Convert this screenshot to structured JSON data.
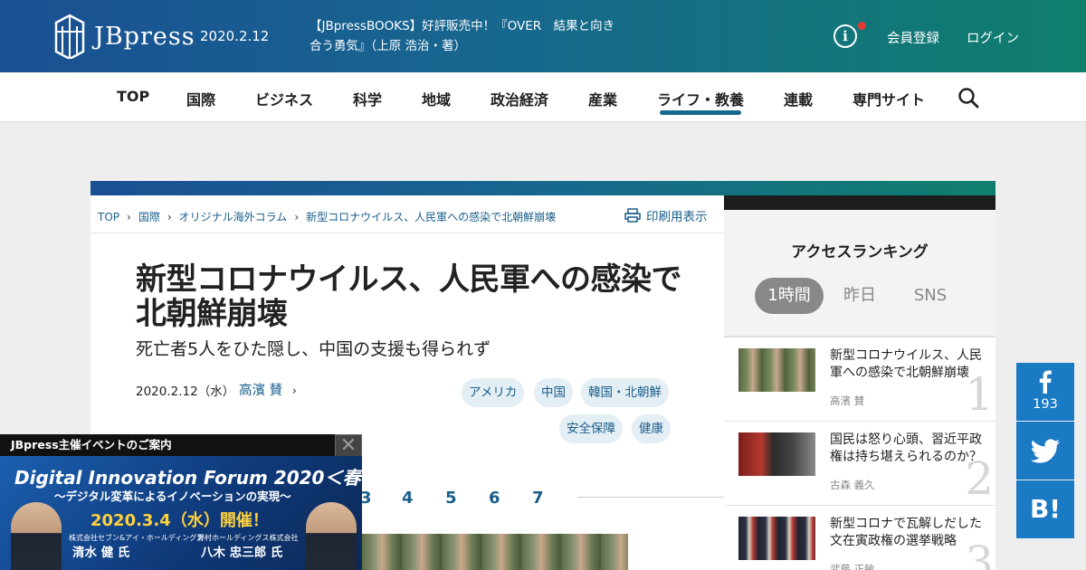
{
  "header": {
    "logo_text": "JBpress",
    "date": "2020.2.12",
    "promo": "【JBpressBOOKS】好評販売中！『OVER　結果と向き合う勇気』（上原 浩治・著）",
    "info_icon": "info-icon",
    "register": "会員登録",
    "login": "ログイン"
  },
  "nav": {
    "items": [
      "TOP",
      "国際",
      "ビジネス",
      "科学",
      "地域",
      "政治経済",
      "産業",
      "ライフ・教養",
      "連載",
      "専門サイト"
    ],
    "active": "ライフ・教養"
  },
  "breadcrumb": [
    "TOP",
    "国際",
    "オリジナル海外コラム",
    "新型コロナウイルス、人民軍への感染で北朝鮮崩壊"
  ],
  "print_label": "印刷用表示",
  "article": {
    "title": "新型コロナウイルス、人民軍への感染で北朝鮮崩壊",
    "subtitle": "死亡者5人をひた隠し、中国の支援も得られず",
    "date": "2020.2.12（水）",
    "author": "高濱 賛",
    "tags": [
      "アメリカ",
      "中国",
      "韓国・北朝鮮",
      "安全保障",
      "健康"
    ],
    "pages": [
      "3",
      "4",
      "5",
      "6",
      "7"
    ]
  },
  "ranking": {
    "title": "アクセスランキング",
    "tabs": [
      "1時間",
      "昨日",
      "SNS"
    ],
    "items": [
      {
        "rank": "1",
        "title": "新型コロナウイルス、人民軍への感染で北朝鮮崩壊",
        "author": "高濱 賛"
      },
      {
        "rank": "2",
        "title": "国民は怒り心頭、習近平政権は持ち堪えられるのか？",
        "author": "古森 義久"
      },
      {
        "rank": "3",
        "title": "新型コロナで瓦解しだした文在寅政権の選挙戦略",
        "author": "武藤 正敏"
      }
    ]
  },
  "social": {
    "facebook_count": "193",
    "hatena_label": "B!"
  },
  "ad": {
    "header": "JBpress主催イベントのご案内",
    "close": "✕",
    "title": "Digital Innovation Forum 2020＜春＞",
    "subtitle": "～デジタル変革によるイノベーションの実現～",
    "date": "2020.3.4（水）開催！",
    "speaker1_company": "株式会社セブン&アイ・ホールディングス",
    "speaker1_name": "清水 健 氏",
    "speaker2_company": "野村ホールディングス株式会社",
    "speaker2_name": "八木 忠三郎 氏"
  },
  "colors": {
    "brand_start": "#1a4f93",
    "brand_end": "#0f7f6c",
    "link": "#1a5e8a",
    "facebook": "#1a7ac4",
    "ad_accent": "#ffd23c"
  }
}
